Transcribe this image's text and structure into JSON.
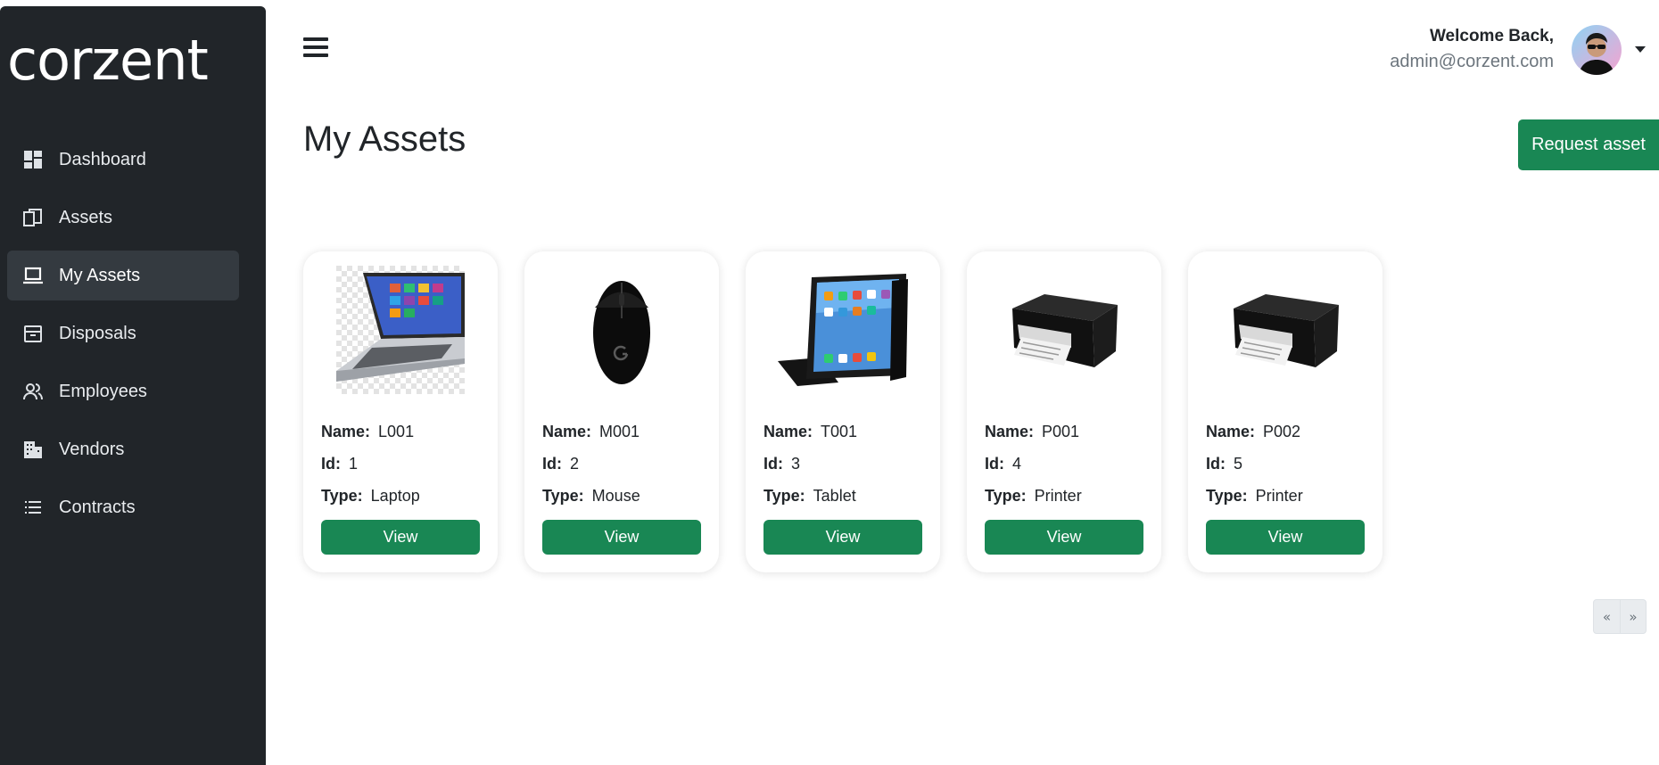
{
  "brand": {
    "logo_text": "corzent"
  },
  "sidebar": {
    "items": [
      {
        "label": "Dashboard",
        "icon": "dashboard-icon",
        "active": false
      },
      {
        "label": "Assets",
        "icon": "assets-icon",
        "active": false
      },
      {
        "label": "My Assets",
        "icon": "laptop-icon",
        "active": true
      },
      {
        "label": "Disposals",
        "icon": "archive-icon",
        "active": false
      },
      {
        "label": "Employees",
        "icon": "people-icon",
        "active": false
      },
      {
        "label": "Vendors",
        "icon": "building-icon",
        "active": false
      },
      {
        "label": "Contracts",
        "icon": "list-icon",
        "active": false
      }
    ]
  },
  "header": {
    "welcome": "Welcome Back,",
    "email": "admin@corzent.com"
  },
  "page": {
    "title": "My Assets",
    "request_button": "Request asset"
  },
  "labels": {
    "name": "Name:",
    "id": "Id:",
    "type": "Type:",
    "view": "View"
  },
  "assets": [
    {
      "name": "L001",
      "id": "1",
      "type": "Laptop",
      "image": "laptop-image"
    },
    {
      "name": "M001",
      "id": "2",
      "type": "Mouse",
      "image": "mouse-image"
    },
    {
      "name": "T001",
      "id": "3",
      "type": "Tablet",
      "image": "tablet-image"
    },
    {
      "name": "P001",
      "id": "4",
      "type": "Printer",
      "image": "printer-image"
    },
    {
      "name": "P002",
      "id": "5",
      "type": "Printer",
      "image": "printer-image"
    }
  ],
  "pagination": {
    "prev": "«",
    "next": "»"
  },
  "colors": {
    "sidebar_bg": "#212529",
    "active_item_bg": "#343a40",
    "primary_green": "#198754"
  }
}
